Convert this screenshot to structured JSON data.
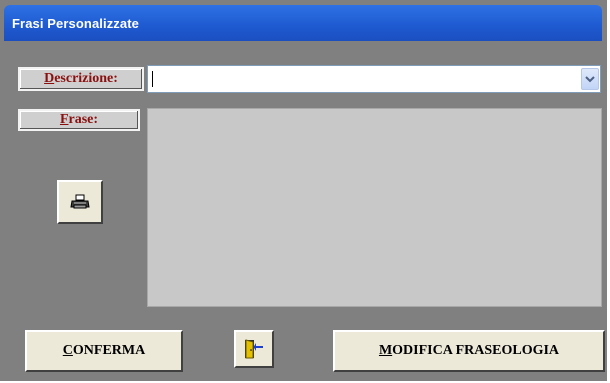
{
  "window": {
    "title": "Frasi Personalizzate"
  },
  "form": {
    "description_label_accel": "D",
    "description_label_rest": "escrizione:",
    "description_value": "",
    "phrase_label_accel": "F",
    "phrase_label_rest": "rase:",
    "phrase_value": ""
  },
  "buttons": {
    "confirm_accel": "C",
    "confirm_rest": "ONFERMA",
    "modify_accel": "M",
    "modify_rest": "ODIFICA FRASEOLOGIA"
  },
  "icons": {
    "print": "printer-icon",
    "exit": "exit-door-icon",
    "dropdown": "chevron-down-icon"
  },
  "colors": {
    "titlebar": "#2f72e6",
    "window_bg": "#808080",
    "label_text": "#8a1010",
    "phrase_area_bg": "#c8c8c8"
  }
}
